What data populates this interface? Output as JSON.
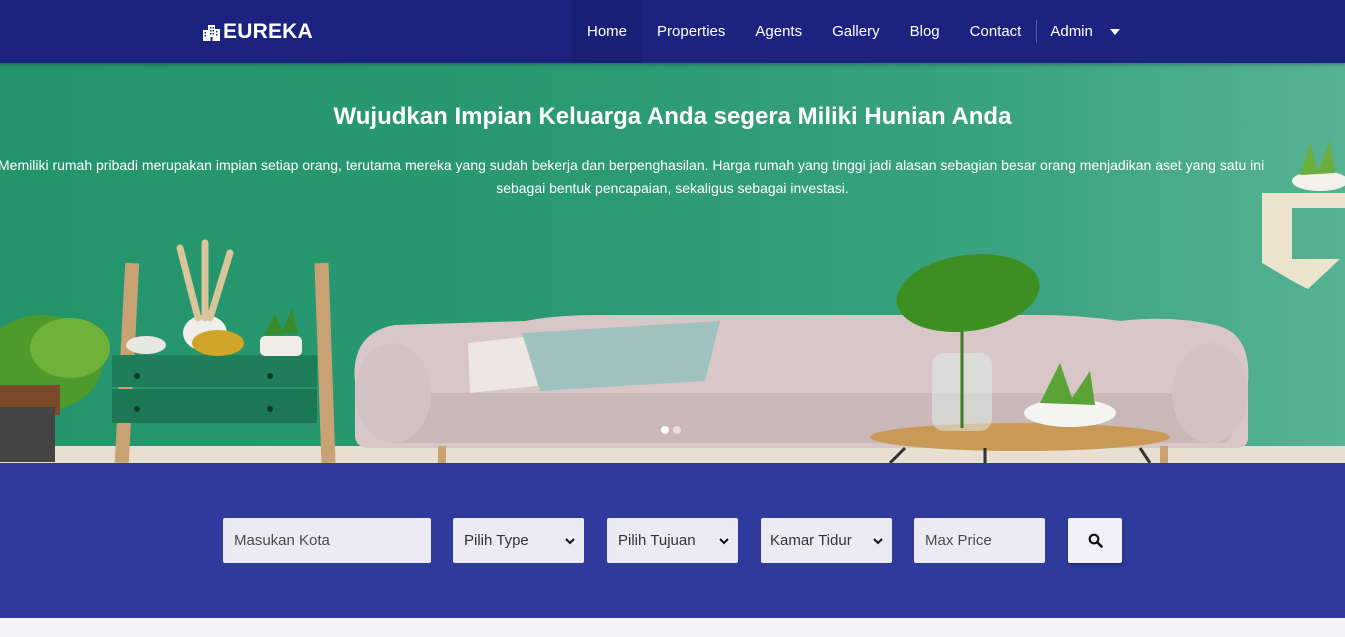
{
  "navbar": {
    "brand": "EUREKA",
    "brand_icon": "building-icon",
    "items": [
      {
        "label": "Home",
        "active": true
      },
      {
        "label": "Properties"
      },
      {
        "label": "Agents"
      },
      {
        "label": "Gallery"
      },
      {
        "label": "Blog"
      },
      {
        "label": "Contact"
      }
    ],
    "user_menu": "Admin",
    "colors": {
      "background": "#1b2280"
    }
  },
  "hero": {
    "title": "Wujudkan Impian Keluarga Anda segera Miliki Hunian Anda",
    "text_line1": "Memiliki rumah pribadi merupakan impian setiap orang, terutama mereka yang sudah bekerja dan berpenghasilan. Harga rumah yang tinggi jadi alasan sebagian besar orang menjadikan aset yang satu ini",
    "text_line2": "sebagai bentuk pencapaian, sekaligus sebagai investasi.",
    "carousel": {
      "slides": 2,
      "active": 1
    }
  },
  "search": {
    "city_placeholder": "Masukan Kota",
    "type_select": "Pilih Type",
    "purpose_select": "Pilih Tujuan",
    "bedroom_select": "Kamar Tidur",
    "price_placeholder": "Max Price",
    "button_icon": "search-icon",
    "colors": {
      "background": "#2f3a9c"
    }
  }
}
